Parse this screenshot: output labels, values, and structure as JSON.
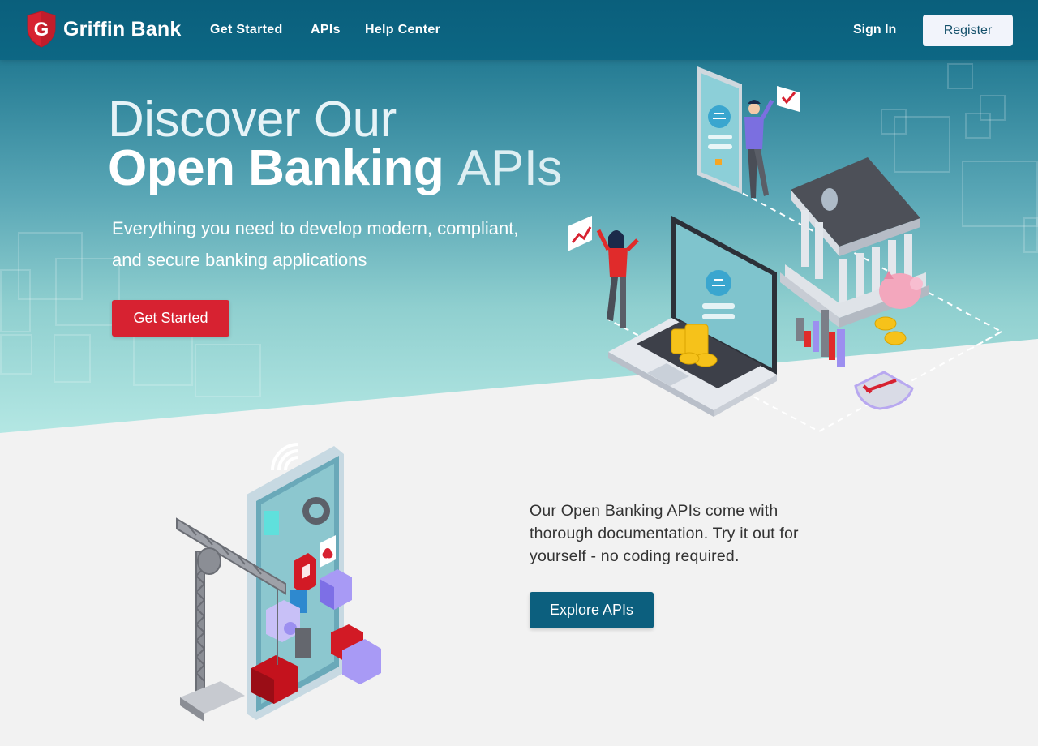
{
  "brand": {
    "name": "Griffin Bank",
    "logo_letter": "G"
  },
  "nav": {
    "links": [
      "Get Started",
      "APIs",
      "Help Center"
    ],
    "sign_in": "Sign In",
    "register": "Register"
  },
  "hero": {
    "title_line1": "Discover Our",
    "title_line2_bold": "Open Banking",
    "title_line2_light": "APIs",
    "subtitle": "Everything you need to develop modern, compliant, and secure banking applications",
    "cta": "Get Started"
  },
  "section": {
    "text": "Our Open Banking APIs come with thorough documentation. Try it out for yourself - no coding required.",
    "cta": "Explore APIs"
  },
  "colors": {
    "nav_bg": "#0a5f7c",
    "cta_red": "#d72231",
    "cta_teal": "#0c5f7e",
    "register_bg": "#f2f4fb"
  }
}
